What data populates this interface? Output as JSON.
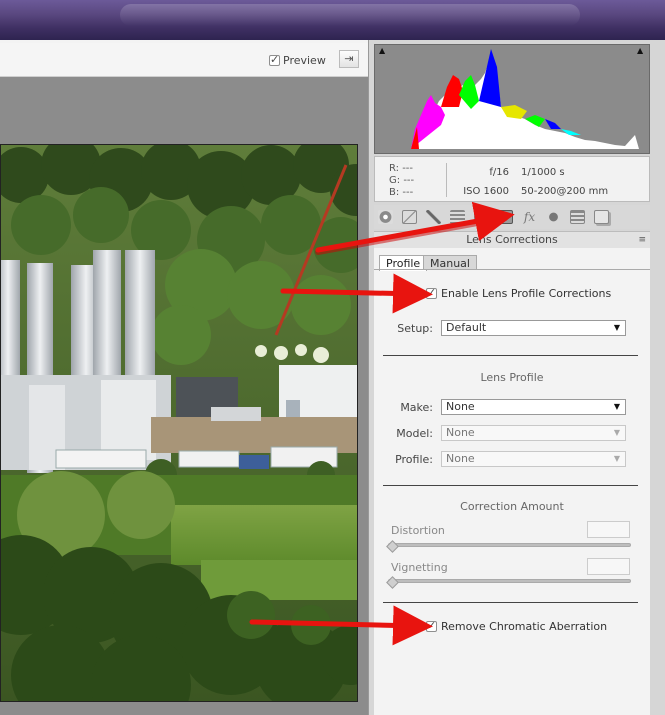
{
  "toolbar": {
    "preview_label": "Preview"
  },
  "info": {
    "r_label": "R:",
    "g_label": "G:",
    "b_label": "B:",
    "r_value": "---",
    "g_value": "---",
    "b_value": "---",
    "aperture": "f/16",
    "shutter": "1/1000 s",
    "iso": "ISO 1600",
    "lens": "50-200@200 mm"
  },
  "panel": {
    "title": "Lens Corrections",
    "tabs": [
      {
        "label": "Profile"
      },
      {
        "label": "Manual"
      }
    ],
    "enable_profile_label": "Enable Lens Profile Corrections",
    "setup_label": "Setup:",
    "setup_value": "Default",
    "lens_profile_title": "Lens Profile",
    "make_label": "Make:",
    "make_value": "None",
    "model_label": "Model:",
    "model_value": "None",
    "profile_label": "Profile:",
    "profile_value": "None",
    "correction_title": "Correction Amount",
    "distortion_label": "Distortion",
    "vignetting_label": "Vignetting",
    "chromatic_label": "Remove Chromatic Aberration"
  },
  "colors": {
    "arrow": "#e8140f",
    "titlebar": "#4a3a74",
    "panel_bg": "#f3f3f3"
  },
  "icons": [
    "basic-icon",
    "tone-curve-icon",
    "detail-icon",
    "hsl-icon",
    "split-tone-icon",
    "lens-corrections-icon",
    "fx-icon",
    "camera-calibration-icon",
    "presets-icon",
    "snapshots-icon"
  ]
}
